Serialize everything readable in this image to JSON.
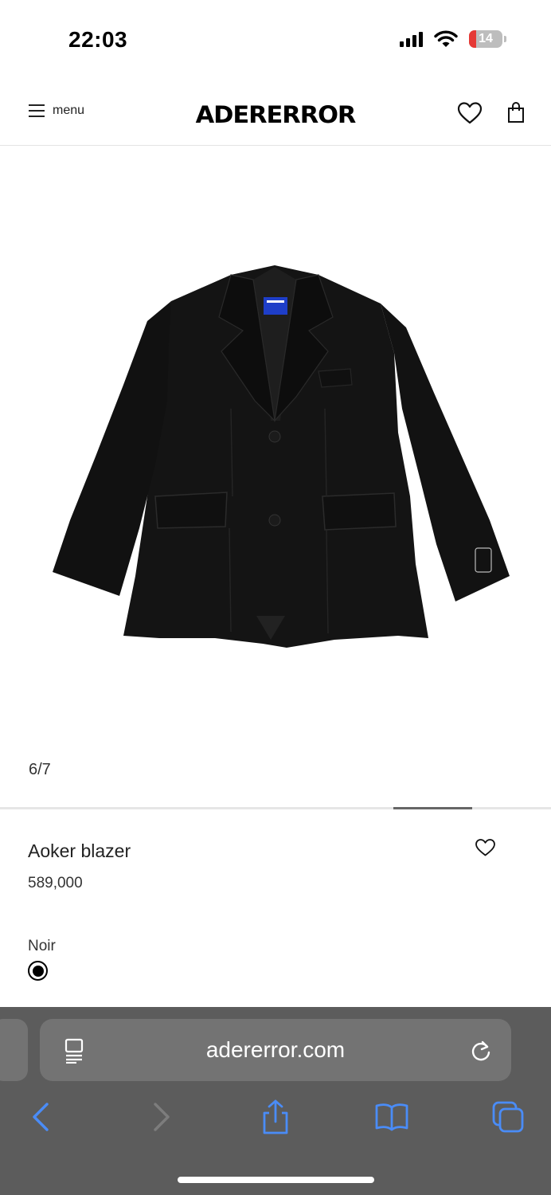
{
  "status_bar": {
    "time": "22:03",
    "battery_level": "14",
    "icons": [
      "signal-icon",
      "wifi-icon",
      "battery-icon"
    ]
  },
  "header": {
    "menu_label": "menu",
    "logo_text": "ADERERROR",
    "icons": [
      "hamburger-icon",
      "heart-icon",
      "shopping-bag-icon"
    ]
  },
  "gallery": {
    "pager": "6/7",
    "current_index": 6,
    "total": 7
  },
  "product": {
    "name": "Aoker blazer",
    "price": "589,000",
    "color_name": "Noir",
    "color_hex": "#000000"
  },
  "browser": {
    "url": "adererror.com",
    "accent_color": "#4a8cf7",
    "icons": [
      "reader-icon",
      "reload-icon",
      "back-icon",
      "forward-icon",
      "share-icon",
      "bookmarks-icon",
      "tabs-icon"
    ]
  }
}
